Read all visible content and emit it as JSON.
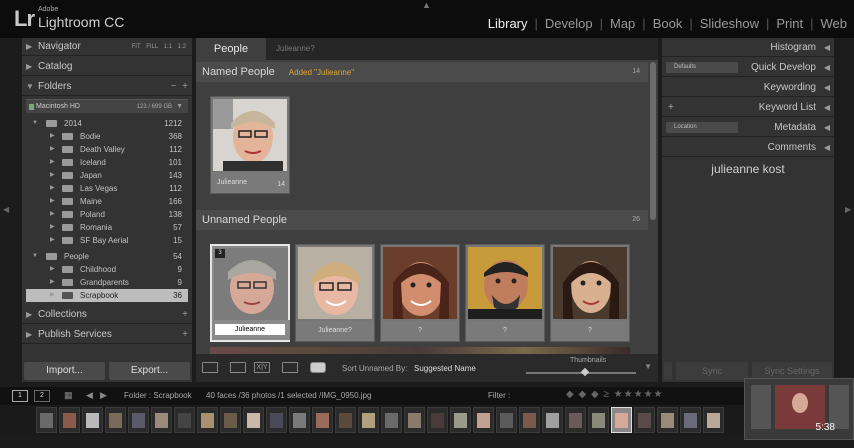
{
  "app": {
    "logo": "Lr",
    "brand_small": "Adobe",
    "brand": "Lightroom CC"
  },
  "modules": [
    {
      "label": "Library",
      "active": true
    },
    {
      "label": "Develop"
    },
    {
      "label": "Map"
    },
    {
      "label": "Book"
    },
    {
      "label": "Slideshow"
    },
    {
      "label": "Print"
    },
    {
      "label": "Web"
    }
  ],
  "left": {
    "navigator": "Navigator",
    "nav_opts": "FIT FILL 1:1 1:2",
    "catalog": "Catalog",
    "folders": "Folders",
    "volume": {
      "name": "Macintosh HD",
      "size": "123 / 699 GB"
    },
    "year": {
      "name": "2014",
      "count": "1212"
    },
    "folders_list": [
      {
        "name": "Bodie",
        "count": "368"
      },
      {
        "name": "Death Valley",
        "count": "112"
      },
      {
        "name": "Iceland",
        "count": "101"
      },
      {
        "name": "Japan",
        "count": "143"
      },
      {
        "name": "Las Vegas",
        "count": "112"
      },
      {
        "name": "Maine",
        "count": "166"
      },
      {
        "name": "Poland",
        "count": "138"
      },
      {
        "name": "Romania",
        "count": "57"
      },
      {
        "name": "SF Bay Aerial",
        "count": "15"
      }
    ],
    "people": {
      "name": "People",
      "count": "54"
    },
    "people_list": [
      {
        "name": "Childhood",
        "count": "9"
      },
      {
        "name": "Grandparents",
        "count": "9"
      },
      {
        "name": "Scrapbook",
        "count": "36"
      }
    ],
    "collections": "Collections",
    "publish": "Publish Services",
    "import": "Import...",
    "export": "Export..."
  },
  "center": {
    "tab_people": "People",
    "tab_search": "Julieanne?",
    "named": {
      "title": "Named People",
      "note": "Added \"Julieanne\"",
      "count": "14"
    },
    "named_face": {
      "label": "Julieanne",
      "count": "14"
    },
    "unnamed": {
      "title": "Unnamed People",
      "count": "26"
    },
    "unnamed_faces": [
      {
        "label": "Julieanne",
        "badge": "3"
      },
      {
        "label": "Julieanne?"
      },
      {
        "label": "?"
      },
      {
        "label": "?"
      },
      {
        "label": "?"
      }
    ]
  },
  "toolbar": {
    "sort_label": "Sort Unnamed By:",
    "sort_value": "Suggested Name",
    "thumbs": "Thumbnails"
  },
  "right": {
    "histogram": "Histogram",
    "quick_develop": "Quick Develop",
    "defaults": "Defaults",
    "keywording": "Keywording",
    "keyword_list": "Keyword List",
    "metadata": "Metadata",
    "meta_sel": "Location",
    "comments": "Comments",
    "keyword_text": "julieanne kost",
    "sync": "Sync",
    "sync_settings": "Sync Settings"
  },
  "filmbar": {
    "pages": [
      "1",
      "2"
    ],
    "crumb": "Folder : Scrapbook",
    "info": "40 faces /36 photos /1 selected /IMG_0950.jpg",
    "filter": "Filter :"
  },
  "video": {
    "time": "5:38"
  },
  "colors": {
    "accent": "#e0a632"
  }
}
